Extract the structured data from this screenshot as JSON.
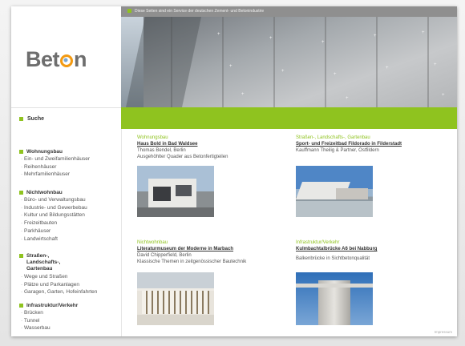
{
  "service_bar": "Diese Seiten sind ein Service der deutschen Zement- und Betonindustrie",
  "logo": {
    "before": "Bet",
    "after": "n"
  },
  "search": {
    "label": "Suche"
  },
  "sidebar": {
    "categories": [
      {
        "title": "Wohnungsbau",
        "items": [
          "Ein- und Zweifamilienhäuser",
          "Reihenhäuser",
          "Mehrfamilienhäuser"
        ]
      },
      {
        "title": "Nichtwohnbau",
        "items": [
          "Büro- und Verwaltungsbau",
          "Industrie- und Gewerbebau",
          "Kultur und Bildungsstätten",
          "Freizeitbauten",
          "Parkhäuser",
          "Landwirtschaft"
        ]
      },
      {
        "title": "Straßen-, Landschafts-, Gartenbau",
        "items": [
          "Wege und Straßen",
          "Plätze und Parkanlagen",
          "Garagen, Garten, Hofeinfahrten"
        ]
      },
      {
        "title": "Infrastruktur/Verkehr",
        "items": [
          "Brücken",
          "Tunnel",
          "Wasserbau"
        ]
      }
    ]
  },
  "teasers": [
    {
      "category": "Wohnungsbau",
      "title": "Haus Bold in Bad Waldsee",
      "line1": "Thomas Bendel, Berlin",
      "line2": "Ausgehöhlter Quader aus Betonfertigteilen"
    },
    {
      "category": "Straßen-, Landschafts-, Gartenbau",
      "title": "Sport- und Freizeitbad Fildorado in Filderstadt",
      "line1": "Kauffmann Theilig & Partner, Ostfildern",
      "line2": ""
    },
    {
      "category": "Nichtwohnbau",
      "title": "Literaturmuseum der Moderne in Marbach",
      "line1": "David Chipperfield, Berlin",
      "line2": "Klassische Themen in zeitgenössischer Bautechnik"
    },
    {
      "category": "Infrastruktur/Verkehr",
      "title": "Kulmbachtalbrücke A6 bei Nabburg",
      "line1": "",
      "line2": "Balkenbrücke in Sichtbetonqualität"
    }
  ],
  "footer": {
    "link": "Impressum"
  },
  "colors": {
    "accent_green": "#8fc31f",
    "logo_orange": "#f39a12",
    "logo_gray": "#6e6e6e"
  }
}
